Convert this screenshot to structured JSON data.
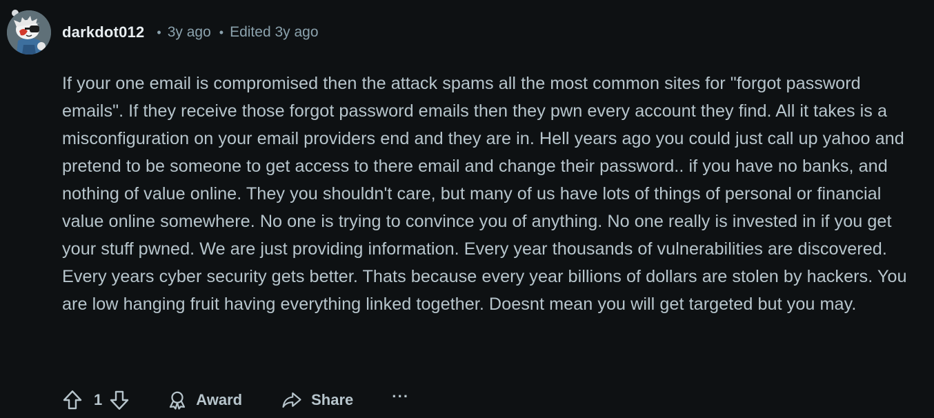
{
  "comment": {
    "username": "darkdot012",
    "separator": "•",
    "posted_ago": "3y ago",
    "edited": "Edited 3y ago",
    "body": "If your one email is compromised then the attack spams all the most common sites for \"forgot password emails\". If they receive those forgot password emails then they pwn every account they find. All it takes is a misconfiguration on your email providers end and they are in. Hell years ago you could just call up yahoo and pretend to be someone to get access to there email and change their password.. if you have no banks, and nothing of value online. They you shouldn't care, but many of us have lots of things of personal or financial value online somewhere. No one is trying to convince you of anything. No one really is invested in if you get your stuff pwned. We are just providing information. Every year thousands of vulnerabilities are discovered. Every years cyber security gets better. Thats because every year billions of dollars are stolen by hackers. You are low hanging fruit having everything linked together. Doesnt mean you will get targeted but you may."
  },
  "actions": {
    "vote_count": "1",
    "award_label": "Award",
    "share_label": "Share",
    "more_label": "···"
  },
  "icons": {
    "upvote": "upvote-arrow-icon",
    "downvote": "downvote-arrow-icon",
    "award": "award-ribbon-icon",
    "share": "share-arrow-icon"
  },
  "colors": {
    "background": "#0e1113",
    "text": "#b7c5cc",
    "username": "#e8eef1",
    "meta": "#8ba2ad"
  }
}
